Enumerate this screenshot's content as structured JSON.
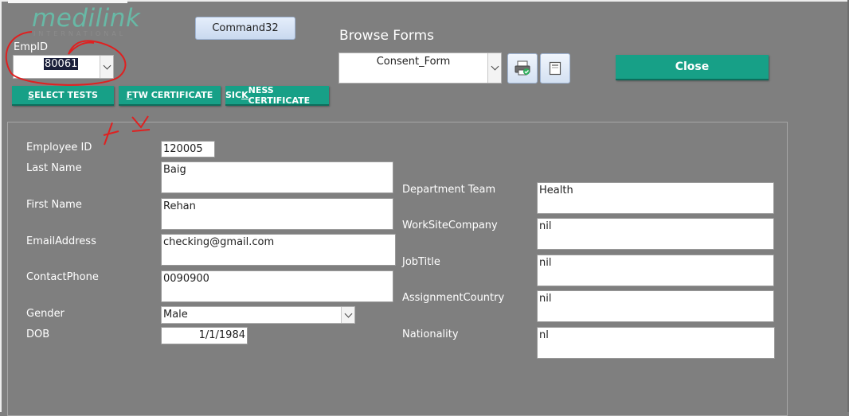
{
  "logo": {
    "text": "medilink",
    "subtext": "INTERNATIONAL"
  },
  "header": {
    "empid_label": "EmpID",
    "empid_value": "80061",
    "command_label": "Command32",
    "browse_forms_label": "Browse Forms",
    "browse_forms_value": "Consent_Form",
    "close_label": "Close"
  },
  "tests_buttons": [
    {
      "pre": "",
      "accel": "S",
      "post": "ELECT TESTS"
    },
    {
      "pre": "",
      "accel": "F",
      "post": "TW CERTIFICATE"
    },
    {
      "pre": "SIC",
      "accel": "K",
      "post": "NESS CERTIFICATE"
    }
  ],
  "form": {
    "employee_id": {
      "label": "Employee ID",
      "value": "120005"
    },
    "last_name": {
      "label": "Last Name",
      "value": "Baig"
    },
    "first_name": {
      "label": "First Name",
      "value": "Rehan"
    },
    "email": {
      "label": "EmailAddress",
      "value": "checking@gmail.com"
    },
    "phone": {
      "label": "ContactPhone",
      "value": "0090900"
    },
    "gender": {
      "label": "Gender",
      "value": "Male"
    },
    "dob": {
      "label": "DOB",
      "value": "1/1/1984"
    },
    "department": {
      "label": "Department Team",
      "value": "Health"
    },
    "worksite": {
      "label": "WorkSiteCompany",
      "value": "nil"
    },
    "jobtitle": {
      "label": "JobTitle",
      "value": "nil"
    },
    "country": {
      "label": "AssignmentCountry",
      "value": "nil"
    },
    "nationality": {
      "label": "Nationality",
      "value": "nl"
    }
  },
  "colors": {
    "background": "#7f7f7f",
    "accent": "#17a087",
    "annotation": "#e02020"
  },
  "icons": [
    "print-preview-icon",
    "form-icon",
    "chevron-down-icon"
  ]
}
